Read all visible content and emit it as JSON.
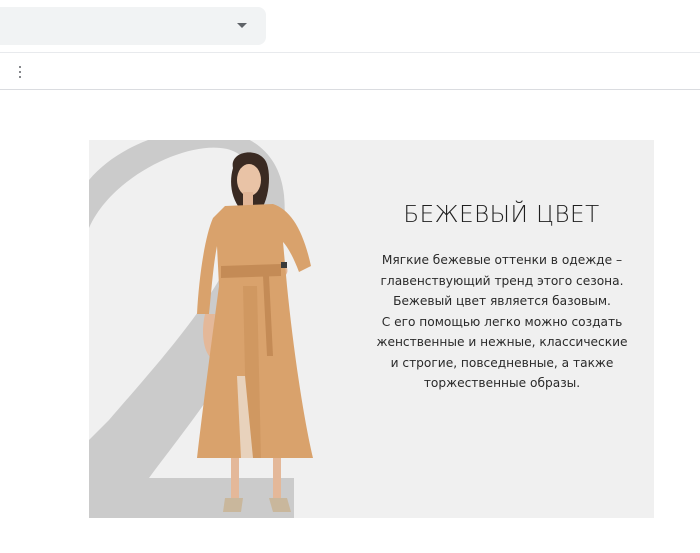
{
  "toolbar": {
    "select_icon": "chevron-down-icon",
    "menu_icon": "more-vert-icon"
  },
  "banner": {
    "number": "2",
    "title": "БЕЖЕВЫЙ ЦВЕТ",
    "description_lines": [
      "Мягкие бежевые оттенки в одежде –",
      "главенствующий тренд этого сезона.",
      "Бежевый цвет является базовым.",
      "С его помощью легко можно создать",
      "женственные и нежные, классические",
      "и строгие, повседневные, а также",
      "торжественные образы."
    ],
    "colors": {
      "background": "#f0f0f0",
      "digit": "#c9c9c9",
      "dress": "#d9a26c"
    }
  }
}
